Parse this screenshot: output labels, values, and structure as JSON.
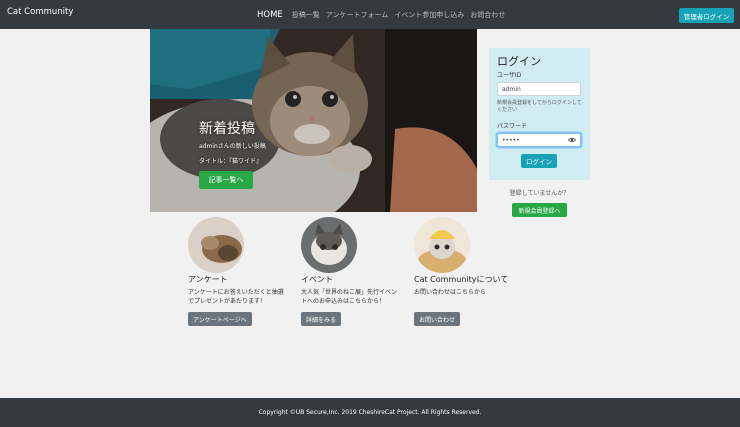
{
  "navbar": {
    "brand": "Cat Community",
    "items": [
      {
        "label": "HOME",
        "active": true
      },
      {
        "label": "投稿一覧"
      },
      {
        "label": "アンケートフォーム"
      },
      {
        "label": "イベント参加申し込み"
      },
      {
        "label": "お問合わせ"
      }
    ],
    "admin_login": "管理者ログイン"
  },
  "hero": {
    "title": "新着投稿",
    "subtitle": "adminさんの新しい投稿",
    "post_title": "タイトル：『猫ワイド』",
    "button": "記事一覧へ"
  },
  "login": {
    "title": "ログイン",
    "user_id_label": "ユーザID",
    "user_id_value": "admin",
    "hint": "新規会員登録をしてからログインしてください",
    "password_label": "パスワード",
    "password_value": "•••••",
    "submit": "ログイン",
    "not_registered": "登録していませんか？",
    "register_button": "新規会員登録へ"
  },
  "cards": [
    {
      "title": "アンケート",
      "text": "アンケートにお答えいただくと抽選でプレゼントがあたります！",
      "button": "アンケートページへ"
    },
    {
      "title": "イベント",
      "text": "大人気「世界のねこ展」先行イベントへのお申込みはこちらから！",
      "button": "詳細をみる"
    },
    {
      "title": "Cat Communityについて",
      "text": "お問い合わせはこちらから",
      "button": "お問い合わせ"
    }
  ],
  "footer": {
    "copyright": "Copyright ©UB Secure,Inc. 2019 CheshireCat Project. All Rights Reserved."
  },
  "colors": {
    "navbar": "#343a40",
    "info": "#17a2b8",
    "success": "#28a745",
    "secondary": "#6c757d",
    "login_panel": "#d1ecf1"
  }
}
